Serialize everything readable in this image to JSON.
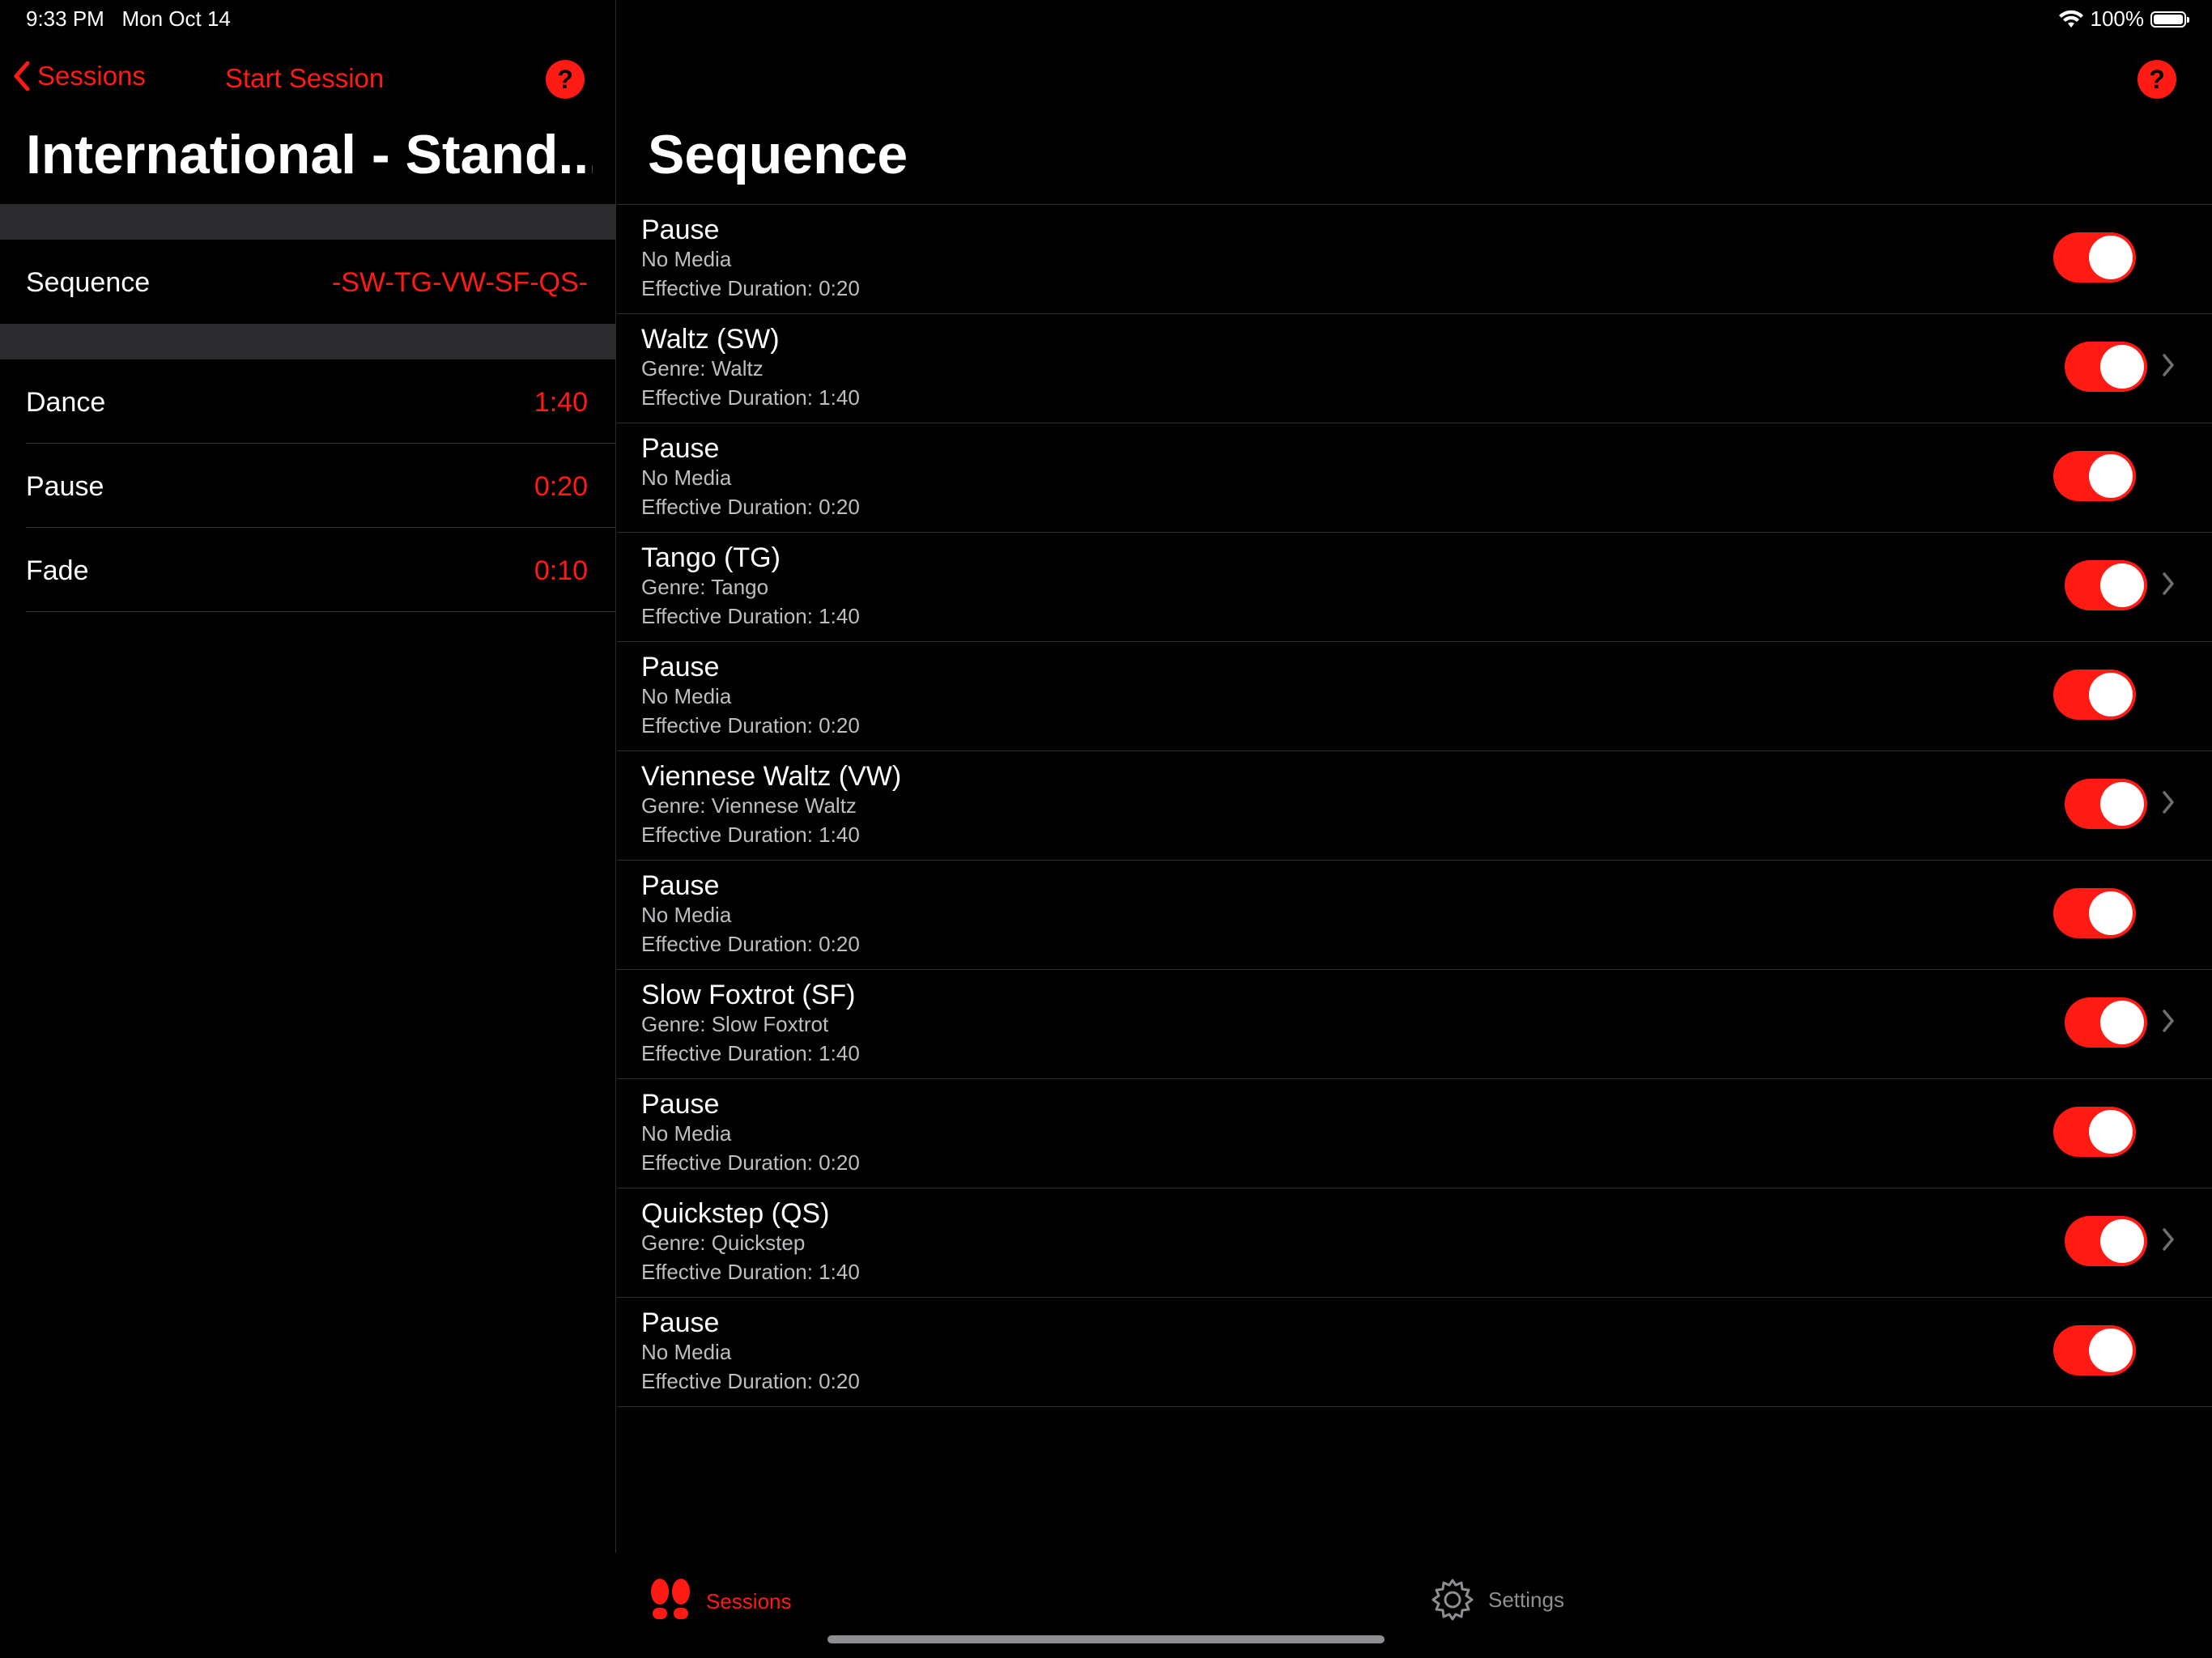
{
  "status_bar": {
    "time": "9:33 PM",
    "date": "Mon Oct 14",
    "battery": "100%"
  },
  "left": {
    "back_label": "Sessions",
    "start_label": "Start Session",
    "title": "International - Stand...",
    "sequence": {
      "label": "Sequence",
      "value": "-SW-TG-VW-SF-QS-"
    },
    "durations": [
      {
        "label": "Dance",
        "value": "1:40"
      },
      {
        "label": "Pause",
        "value": "0:20"
      },
      {
        "label": "Fade",
        "value": "0:10"
      }
    ]
  },
  "right": {
    "title": "Sequence",
    "items": [
      {
        "title": "Pause",
        "sub": "No Media",
        "duration": "Effective Duration: 0:20",
        "enabled": true,
        "chevron": false
      },
      {
        "title": "Waltz (SW)",
        "sub": "Genre: Waltz",
        "duration": "Effective Duration: 1:40",
        "enabled": true,
        "chevron": true
      },
      {
        "title": "Pause",
        "sub": "No Media",
        "duration": "Effective Duration: 0:20",
        "enabled": true,
        "chevron": false
      },
      {
        "title": "Tango (TG)",
        "sub": "Genre: Tango",
        "duration": "Effective Duration: 1:40",
        "enabled": true,
        "chevron": true
      },
      {
        "title": "Pause",
        "sub": "No Media",
        "duration": "Effective Duration: 0:20",
        "enabled": true,
        "chevron": false
      },
      {
        "title": "Viennese Waltz (VW)",
        "sub": "Genre: Viennese Waltz",
        "duration": "Effective Duration: 1:40",
        "enabled": true,
        "chevron": true
      },
      {
        "title": "Pause",
        "sub": "No Media",
        "duration": "Effective Duration: 0:20",
        "enabled": true,
        "chevron": false
      },
      {
        "title": "Slow Foxtrot (SF)",
        "sub": "Genre: Slow Foxtrot",
        "duration": "Effective Duration: 1:40",
        "enabled": true,
        "chevron": true
      },
      {
        "title": "Pause",
        "sub": "No Media",
        "duration": "Effective Duration: 0:20",
        "enabled": true,
        "chevron": false
      },
      {
        "title": "Quickstep (QS)",
        "sub": "Genre: Quickstep",
        "duration": "Effective Duration: 1:40",
        "enabled": true,
        "chevron": true
      },
      {
        "title": "Pause",
        "sub": "No Media",
        "duration": "Effective Duration: 0:20",
        "enabled": true,
        "chevron": false
      }
    ]
  },
  "tabbar": {
    "sessions_label": "Sessions",
    "settings_label": "Settings"
  },
  "colors": {
    "accent": "#ff1a14",
    "background": "#000000",
    "separator": "#2c2c2e"
  },
  "icons": [
    "chevron-left-icon",
    "help-icon",
    "chevron-right-icon",
    "footprints-icon",
    "gear-icon",
    "wifi-icon",
    "battery-icon"
  ]
}
